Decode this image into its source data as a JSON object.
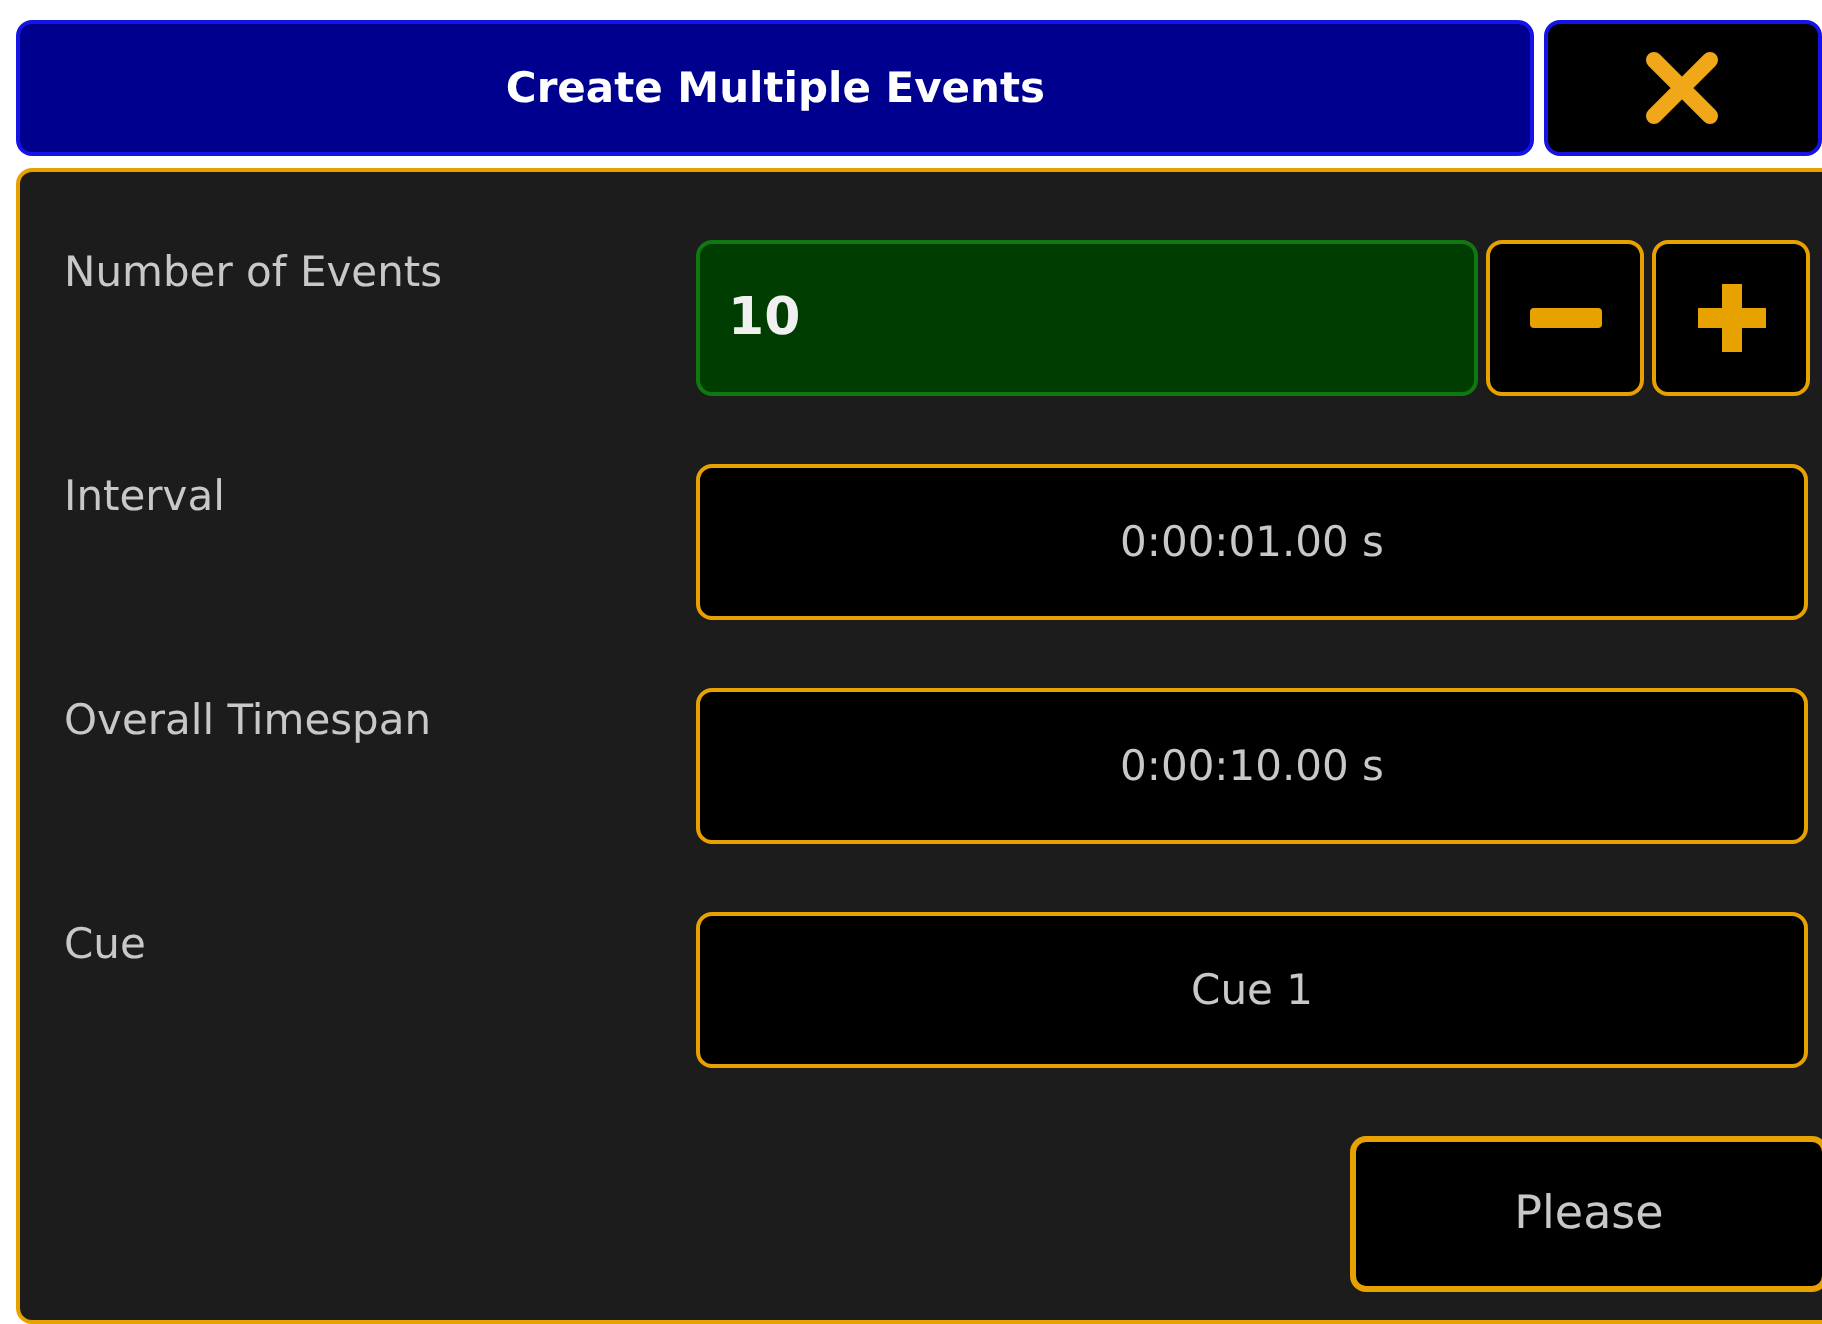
{
  "dialog": {
    "title": "Create Multiple Events"
  },
  "rows": [
    {
      "kind": "stepper",
      "label": "Number of Events",
      "value": "10"
    },
    {
      "kind": "value",
      "label": "Interval",
      "value": "0:00:01.00 s"
    },
    {
      "kind": "value",
      "label": "Overall Timespan",
      "value": "0:00:10.00 s"
    },
    {
      "kind": "value",
      "label": "Cue",
      "value": "Cue 1"
    }
  ],
  "buttons": [
    "Please"
  ]
}
